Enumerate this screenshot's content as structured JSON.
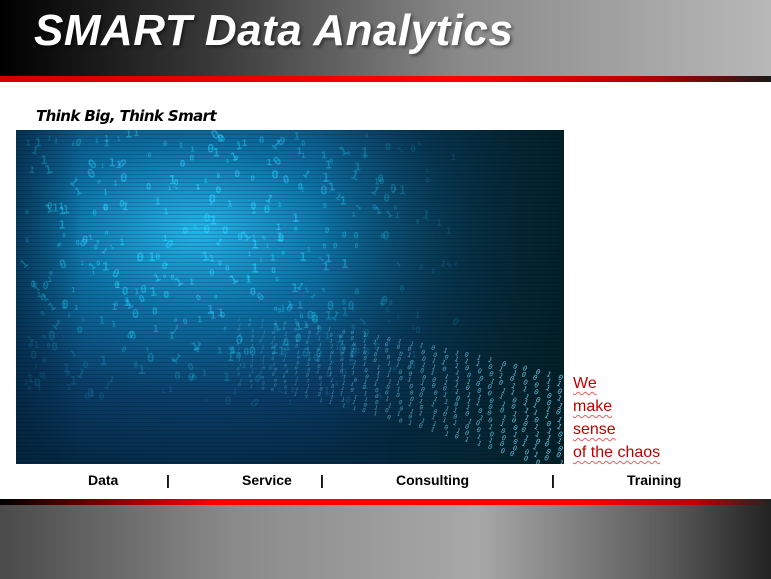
{
  "slide": {
    "title": "SMART Data Analytics",
    "tagline": "Think Big, Think Smart",
    "image": {
      "name": "binary-data-stream-image"
    },
    "statement": [
      "We",
      "make",
      "sense",
      "of the chaos"
    ],
    "nav": {
      "items": [
        "Data",
        "Service",
        "Consulting",
        "Training"
      ],
      "separator": "|"
    },
    "colors": {
      "title": "#ffffff",
      "accent_red": "#ff0000",
      "statement": "#c00000",
      "image_glow": "#1fd0ff",
      "image_dark": "#042a44"
    }
  }
}
